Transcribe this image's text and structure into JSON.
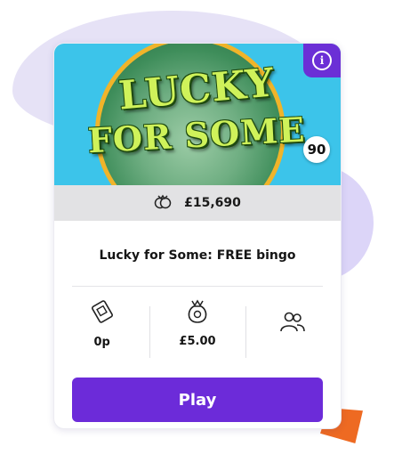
{
  "game": {
    "logo_line1": "LUCKY",
    "logo_line2": "FOR SOME",
    "ball_number": "90",
    "info_icon": "i",
    "jackpot": "£15,690",
    "title": "Lucky for Some: FREE bingo"
  },
  "stats": {
    "ticket_price": "0p",
    "prize": "£5.00"
  },
  "actions": {
    "play_label": "Play"
  },
  "colors": {
    "accent": "#6c2bd9",
    "banner_bg": "#3cc4ea",
    "logo_text": "#cff25a",
    "orange_shape": "#ee6a22"
  }
}
